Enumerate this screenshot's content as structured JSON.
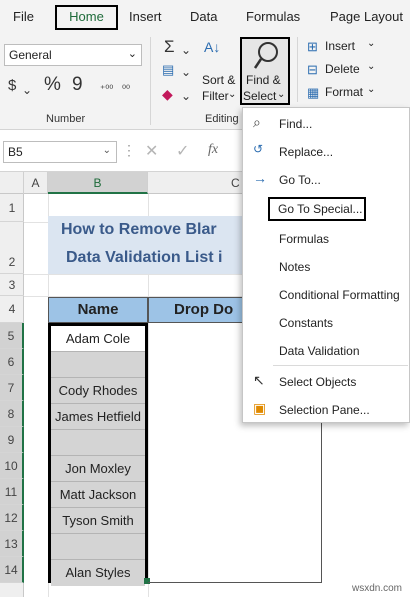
{
  "tabs": {
    "file": "File",
    "home": "Home",
    "insert": "Insert",
    "data": "Data",
    "formulas": "Formulas",
    "page_layout": "Page Layout"
  },
  "ribbon": {
    "number_format": "General",
    "number_group": "Number",
    "percent_symbol": "%",
    "comma_symbol": "9",
    "sort_filter_line1": "Sort &",
    "sort_filter_line2": "Filter",
    "find_select_line1": "Find &",
    "find_select_line2": "Select",
    "editing_group": "Editing",
    "insert": "Insert",
    "delete": "Delete",
    "format": "Format"
  },
  "formula_bar": {
    "name_box": "B5",
    "fx": "fx"
  },
  "columns": [
    "A",
    "B",
    "C"
  ],
  "rows": [
    "1",
    "2",
    "3",
    "4",
    "5",
    "6",
    "7",
    "8",
    "9",
    "10",
    "11",
    "12",
    "13",
    "14"
  ],
  "sheet": {
    "title_line1": "How to Remove Blar",
    "title_line2": "Data Validation List i",
    "header_name": "Name",
    "header_drop": "Drop Do",
    "names": [
      "Adam Cole",
      "",
      "Cody Rhodes",
      "James Hetfield",
      "",
      "Jon Moxley",
      "Matt Jackson",
      "Tyson Smith",
      "",
      "Alan Styles"
    ]
  },
  "menu": {
    "find": "Find...",
    "replace": "Replace...",
    "go_to": "Go To...",
    "go_to_special": "Go To Special...",
    "formulas": "Formulas",
    "notes": "Notes",
    "conditional_formatting": "Conditional Formatting",
    "constants": "Constants",
    "data_validation": "Data Validation",
    "select_objects": "Select Objects",
    "selection_pane": "Selection Pane..."
  },
  "watermark": "wsxdn.com"
}
